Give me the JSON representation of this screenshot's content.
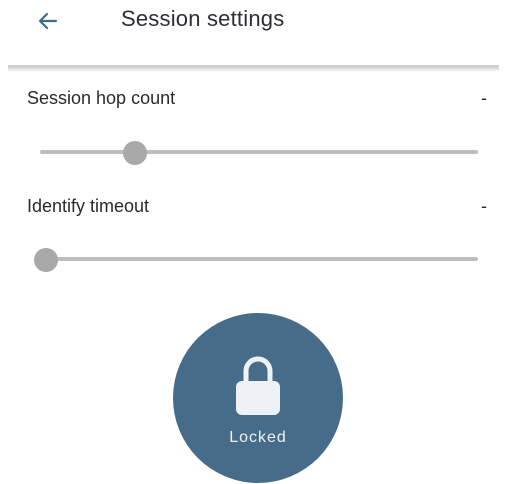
{
  "header": {
    "back_icon": "arrow-left-icon",
    "title": "Session settings"
  },
  "settings": [
    {
      "label": "Session hop count",
      "value": "-",
      "slider_fraction": 0.21
    },
    {
      "label": "Identify timeout",
      "value": "-",
      "slider_fraction": 0.0
    }
  ],
  "lock_button": {
    "icon": "lock-icon",
    "label": "Locked",
    "color": "#466c89"
  },
  "colors": {
    "accent": "#3f6b8a",
    "slider_track": "#bdbdbd",
    "slider_thumb": "#a9a9a9"
  }
}
